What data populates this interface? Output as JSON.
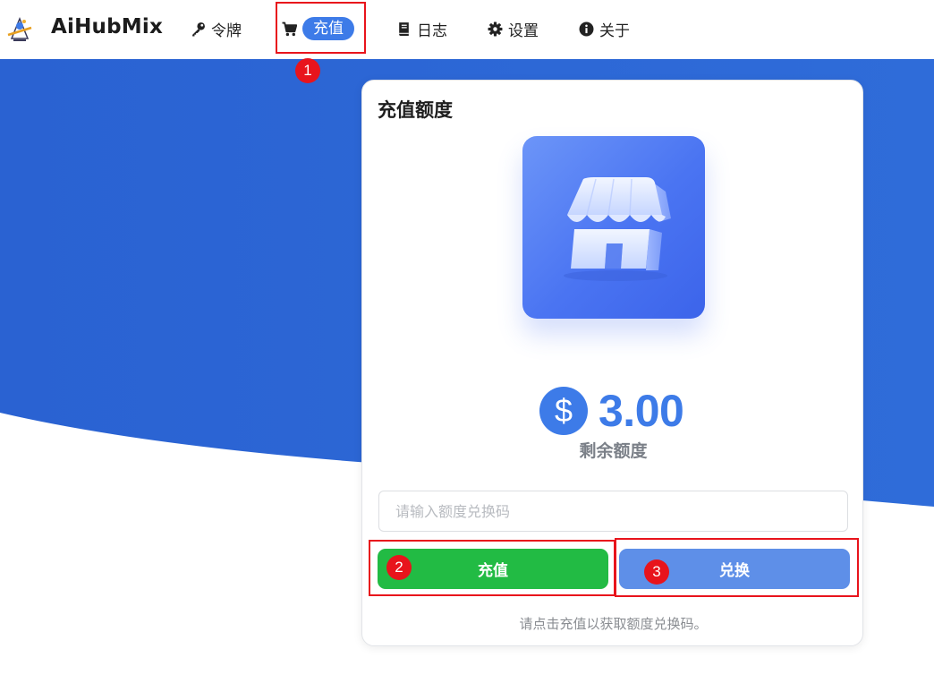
{
  "app": {
    "brand": "AiHubMix"
  },
  "nav": {
    "token_label": "令牌",
    "recharge_label": "充值",
    "log_label": "日志",
    "settings_label": "设置",
    "about_label": "关于"
  },
  "card": {
    "title": "充值额度",
    "balance_symbol": "$",
    "balance_amount": "3.00",
    "balance_label": "剩余额度",
    "input_placeholder": "请输入额度兑换码",
    "input_value": "",
    "recharge_button": "充值",
    "redeem_button": "兑换",
    "hint": "请点击充值以获取额度兑换码。"
  },
  "annotations": [
    "1",
    "2",
    "3"
  ],
  "icons": {
    "token": "key-icon",
    "recharge": "cart-icon",
    "log": "book-icon",
    "settings": "gear-icon",
    "about": "info-icon",
    "store": "store-icon",
    "balance": "dollar-icon"
  },
  "colors": {
    "accent": "#3d7be8",
    "background_blue": "#2e6bd8",
    "recharge_green": "#22bb44",
    "redeem_blue": "#5e8fe8",
    "annotation_red": "#e8141c"
  }
}
